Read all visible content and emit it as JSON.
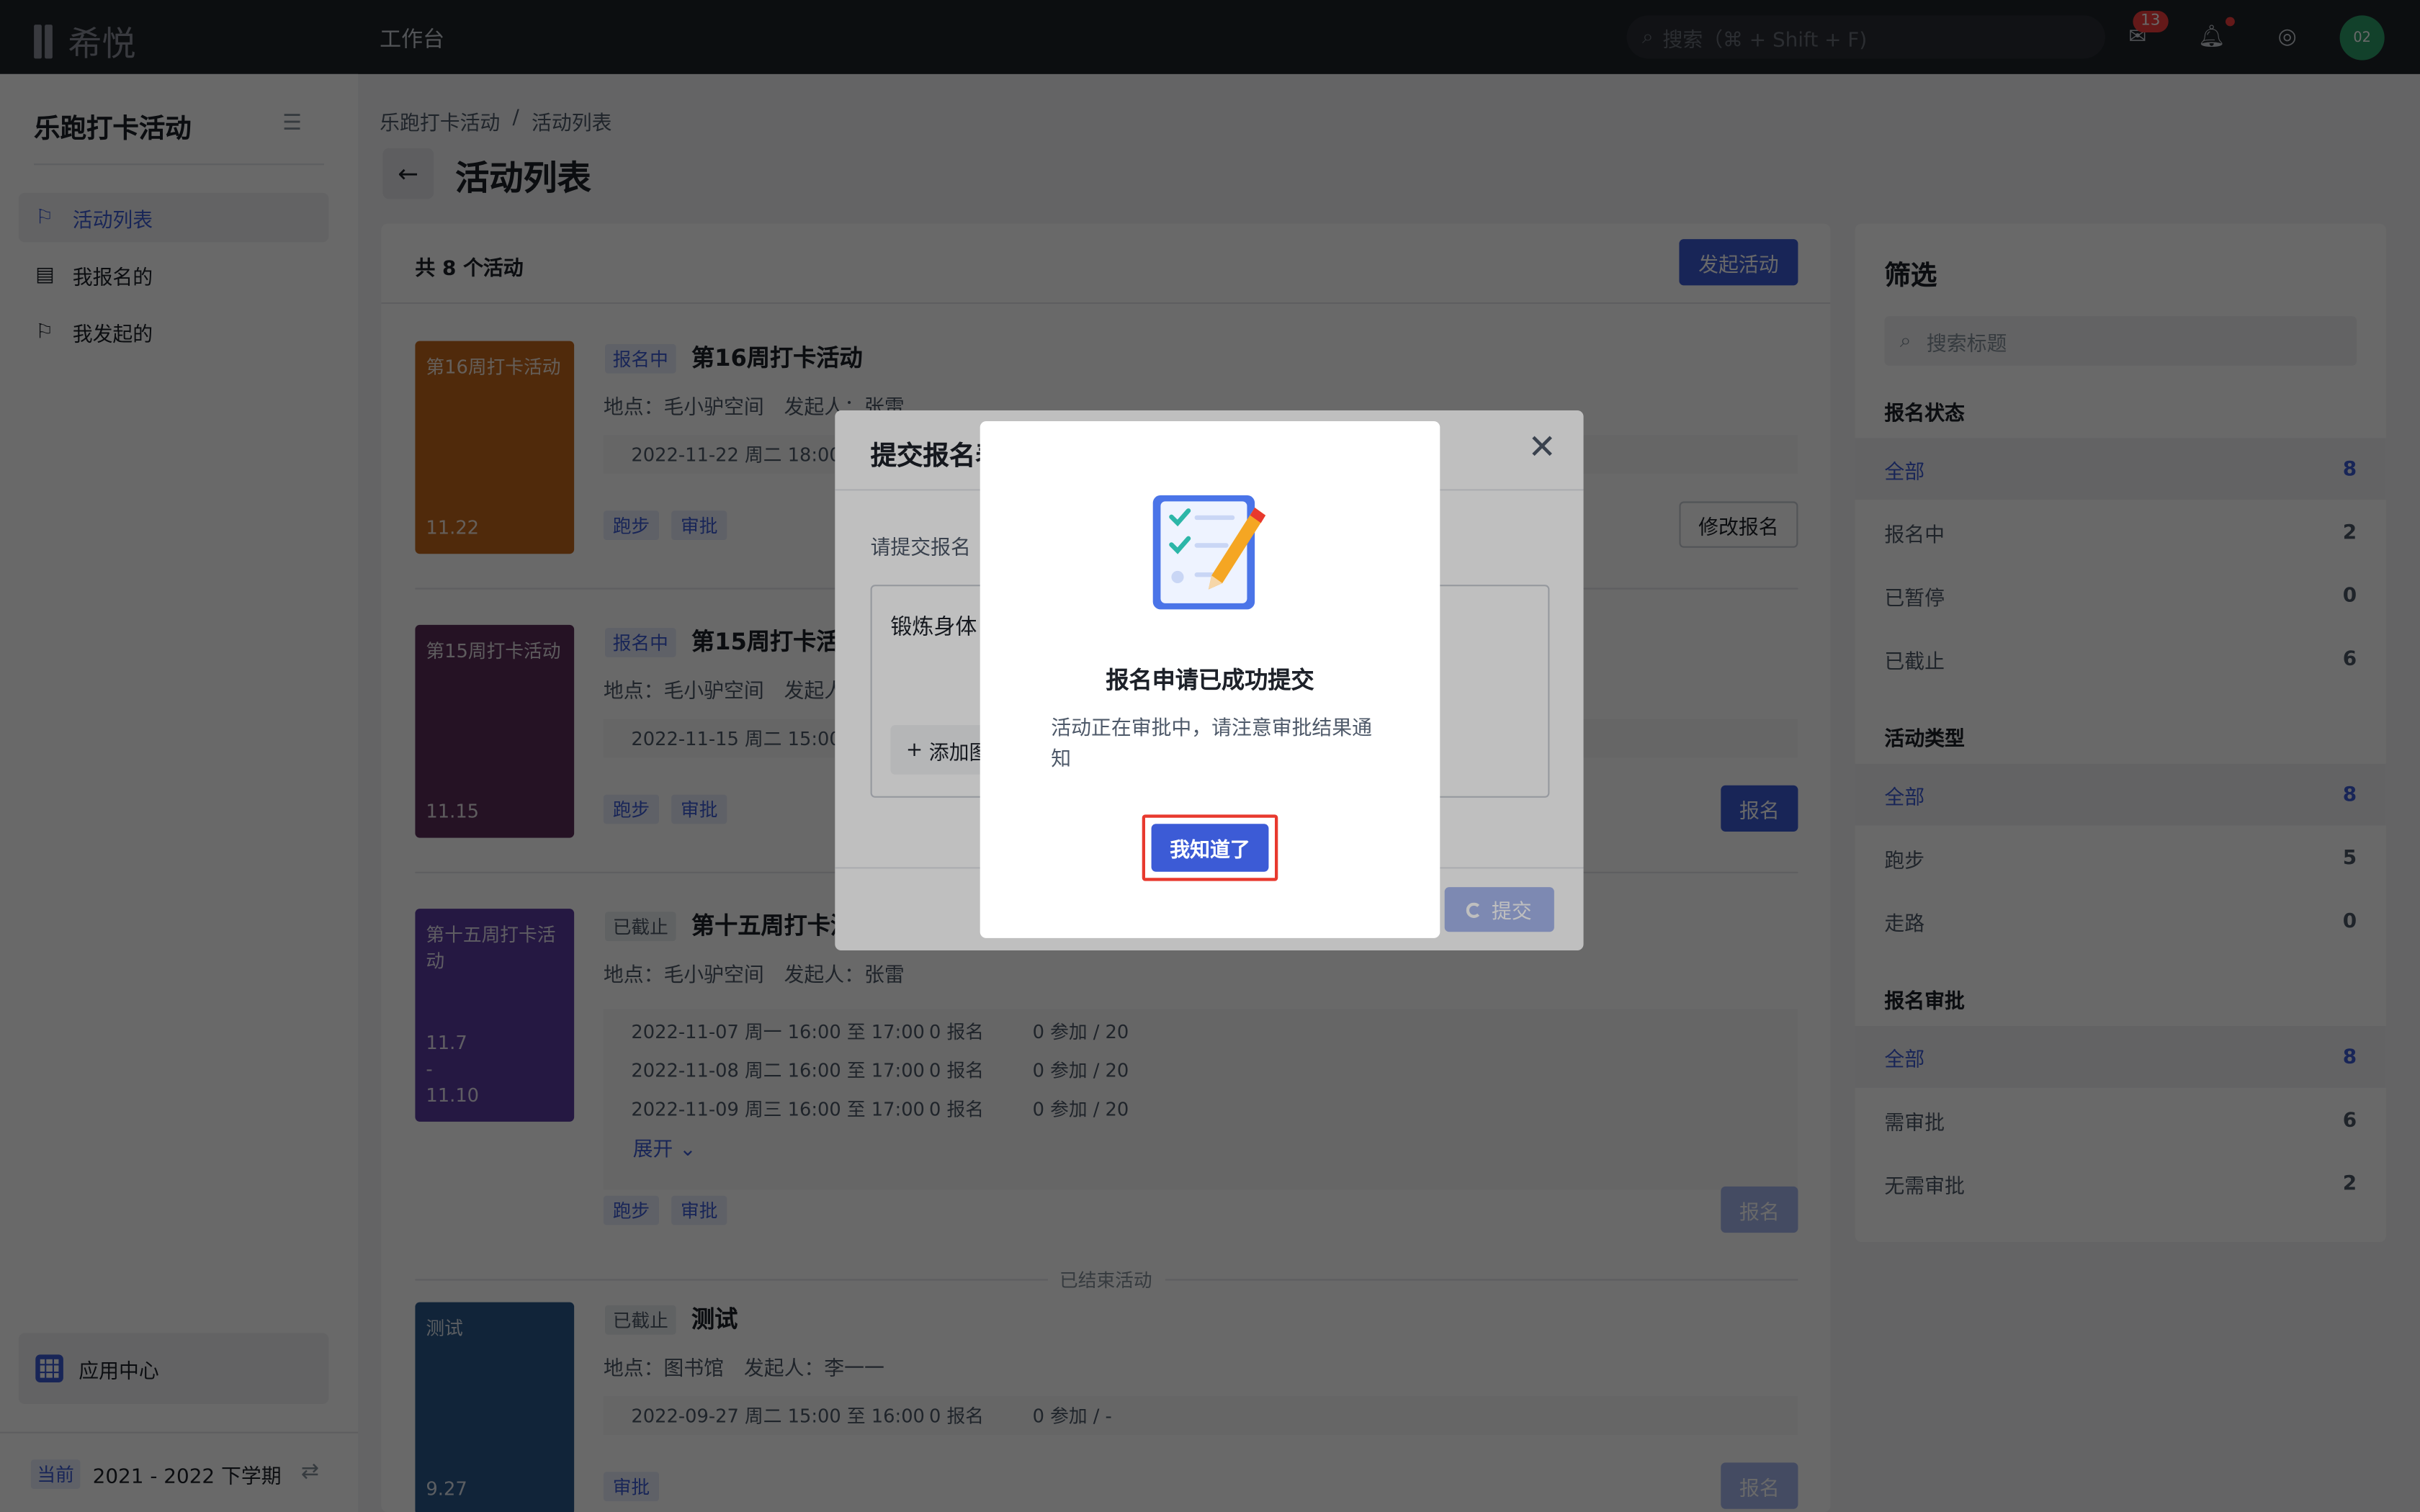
{
  "topbar": {
    "logo_text": "希悦",
    "nav_label": "工作台",
    "search_placeholder": "搜索（⌘ + Shift + F)",
    "message_badge": "13",
    "avatar_text": "02"
  },
  "sidebar": {
    "title": "乐跑打卡活动",
    "items": [
      {
        "label": "活动列表",
        "active": true
      },
      {
        "label": "我报名的",
        "active": false
      },
      {
        "label": "我发起的",
        "active": false
      }
    ],
    "app_center": "应用中心",
    "term_tag": "当前",
    "term": "2021 - 2022 下学期"
  },
  "header": {
    "breadcrumb": [
      "乐跑打卡活动",
      "/",
      "活动列表"
    ],
    "title": "活动列表"
  },
  "main": {
    "count": "共 8 个活动",
    "launch_button": "发起活动",
    "ended_divider": "已结束活动",
    "activities": [
      {
        "cover_title": "第16周打卡活动",
        "cover_date": "11.22",
        "cover_color": "#c4661c",
        "status": "报名中",
        "title": "第16周打卡活动",
        "meta": "地点：毛小驴空间　发起人：张雷",
        "sessions": [
          [
            "2022-11-22 周二 18:00",
            "",
            ""
          ]
        ],
        "tags": [
          "跑步",
          "审批"
        ],
        "button": "修改报名"
      },
      {
        "cover_title": "第15周打卡活动",
        "cover_date": "11.15",
        "cover_color": "#5b2e5a",
        "status": "报名中",
        "title": "第15周打卡活动",
        "meta": "地点：毛小驴空间　发起人：张雷",
        "sessions": [
          [
            "2022-11-15 周二 15:00",
            "",
            ""
          ]
        ],
        "tags": [
          "跑步",
          "审批"
        ],
        "button": "报名"
      },
      {
        "cover_title": "第十五周打卡活动",
        "cover_date": "11.7\n-\n11.10",
        "cover_color": "#5c3ca0",
        "status": "已截止",
        "title": "第十五周打卡活动",
        "meta": "地点：毛小驴空间　发起人：张雷",
        "sessions": [
          [
            "2022-11-07 周一 16:00 至 17:00",
            "0 报名",
            "0 参加 / 20"
          ],
          [
            "2022-11-08 周二 16:00 至 17:00",
            "0 报名",
            "0 参加 / 20"
          ],
          [
            "2022-11-09 周三 16:00 至 17:00",
            "0 报名",
            "0 参加 / 20"
          ]
        ],
        "expand": "展开",
        "tags": [
          "跑步",
          "审批"
        ],
        "button": "报名"
      },
      {
        "cover_title": "测试",
        "cover_date": "9.27",
        "cover_color": "#2b5a8c",
        "status": "已截止",
        "title": "测试",
        "meta": "地点：图书馆　发起人：李一一",
        "sessions": [
          [
            "2022-09-27 周二 15:00 至 16:00",
            "0 报名",
            "0 参加 / -"
          ]
        ],
        "tags": [
          "审批"
        ],
        "button": "报名"
      }
    ]
  },
  "filter": {
    "title": "筛选",
    "search_placeholder": "搜索标题",
    "groups": [
      {
        "name": "报名状态",
        "rows": [
          [
            "全部",
            "8"
          ],
          [
            "报名中",
            "2"
          ],
          [
            "已暂停",
            "0"
          ],
          [
            "已截止",
            "6"
          ]
        ]
      },
      {
        "name": "活动类型",
        "rows": [
          [
            "全部",
            "8"
          ],
          [
            "跑步",
            "5"
          ],
          [
            "走路",
            "0"
          ]
        ]
      },
      {
        "name": "报名审批",
        "rows": [
          [
            "全部",
            "8"
          ],
          [
            "需审批",
            "6"
          ],
          [
            "无需审批",
            "2"
          ]
        ]
      }
    ]
  },
  "form_modal": {
    "title": "提交报名表",
    "label": "请提交报名",
    "textarea_value": "锻炼身体",
    "add_button": "添加图",
    "submit": "提交"
  },
  "success_modal": {
    "title": "报名申请已成功提交",
    "body": "活动正在审批中，请注意审批结果通知",
    "button": "我知道了"
  },
  "colors": {
    "primary": "#3c5bd6",
    "highlight": "#e8392e"
  }
}
